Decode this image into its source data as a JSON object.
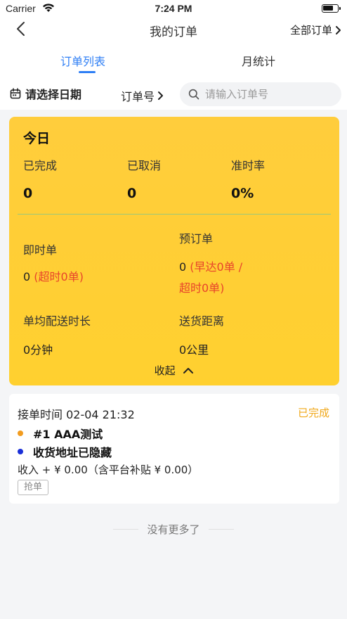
{
  "status_bar": {
    "carrier": "Carrier",
    "time": "7:24 PM"
  },
  "nav": {
    "title": "我的订单",
    "right_label": "全部订单"
  },
  "tabs": [
    {
      "label": "订单列表",
      "active": true
    },
    {
      "label": "月统计",
      "active": false
    }
  ],
  "filter": {
    "date_label": "请选择日期",
    "order_select_label": "订单号",
    "search_placeholder": "请输入订单号"
  },
  "today_stats": {
    "title": "今日",
    "completed_label": "已完成",
    "completed_value": "0",
    "cancelled_label": "已取消",
    "cancelled_value": "0",
    "ontime_label": "准时率",
    "ontime_value": "0%",
    "instant_label": "即时单",
    "instant_count": "0",
    "instant_note": "(超时0单)",
    "reserve_label": "预订单",
    "reserve_count": "0",
    "reserve_note_line1": "(早达0单 /",
    "reserve_note_line2": "超时0单)",
    "avg_time_label": "单均配送时长",
    "avg_time_value": "0分钟",
    "distance_label": "送货距离",
    "distance_value": "0公里",
    "collapse_label": "收起"
  },
  "orders": [
    {
      "time_text": "接单时间 02-04 21:32",
      "status": "已完成",
      "store": "#1 AAA测试",
      "address": "收货地址已隐藏",
      "income": "收入 + ¥ 0.00（含平台补贴 ¥ 0.00）",
      "tag": "抢单"
    }
  ],
  "footer": {
    "no_more": "没有更多了"
  },
  "colors": {
    "accent": "#2f7ff5",
    "card_yellow": "#ffcd3c",
    "warning_red": "#e8442b",
    "status_completed": "#f0a81a",
    "dot_store": "#f29c1f",
    "dot_address": "#1a2fd8"
  }
}
